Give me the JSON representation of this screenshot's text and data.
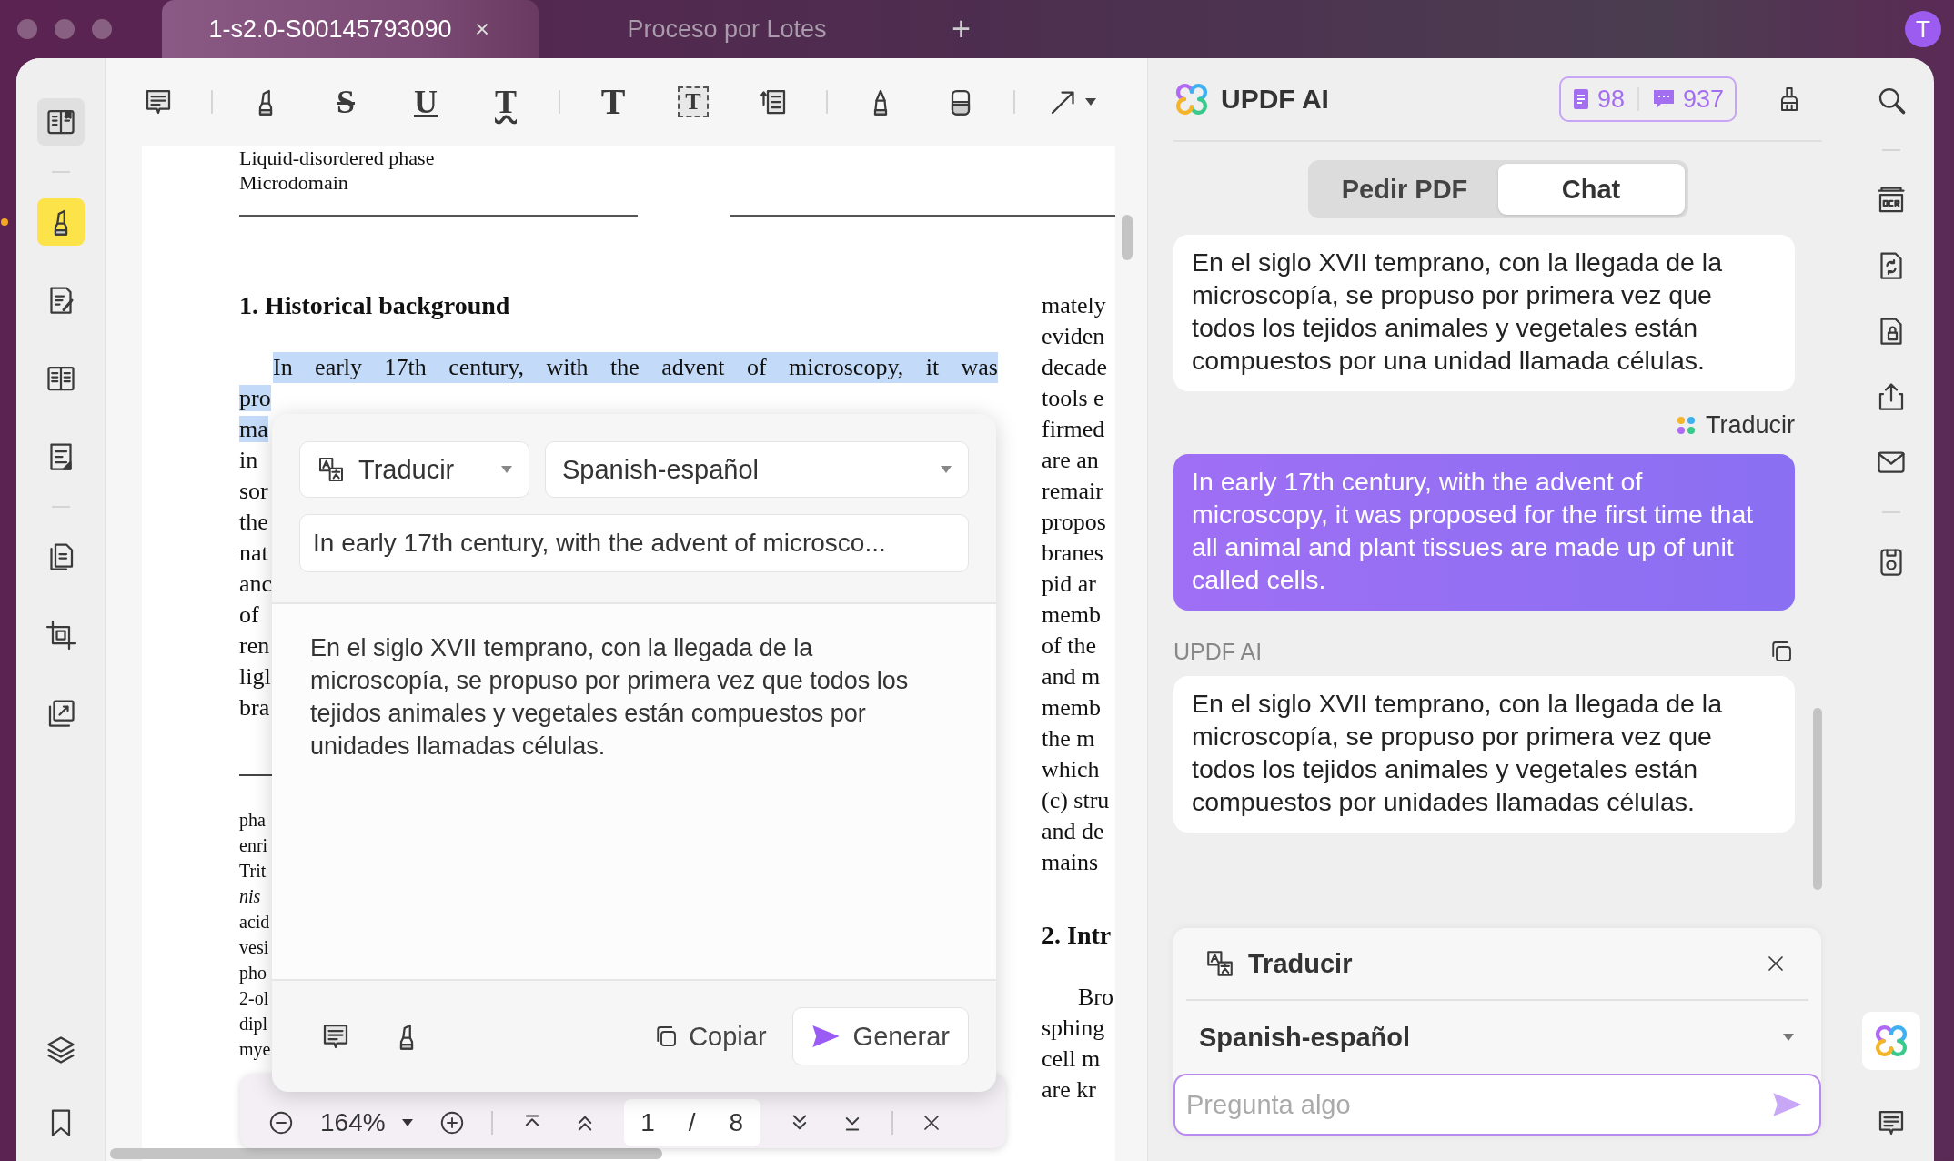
{
  "title_bar": {
    "tabs": [
      {
        "label": "1-s2.0-S00145793090",
        "selected": true
      },
      {
        "label": "Proceso por Lotes",
        "selected": false
      }
    ],
    "new_tab": "+",
    "avatar": "T"
  },
  "left_sidebar": {
    "reader_mode": {
      "on": true
    },
    "tools": [
      {
        "selected": true
      },
      {
        "selected": false
      },
      {
        "selected": false
      },
      {
        "selected": false
      },
      {
        "selected": false
      },
      {
        "selected": false
      },
      {
        "selected": false
      }
    ]
  },
  "toolbar": {
    "tools": [
      {
        "kind": "comment"
      },
      {
        "kind": "separator"
      },
      {
        "kind": "highlight"
      },
      {
        "kind": "strikethrough",
        "glyph": "S"
      },
      {
        "kind": "underline",
        "glyph": "U"
      },
      {
        "kind": "squiggly",
        "glyph": "T"
      },
      {
        "kind": "separator"
      },
      {
        "kind": "text",
        "glyph": "T"
      },
      {
        "kind": "textbox",
        "glyph": "T"
      },
      {
        "kind": "callout"
      },
      {
        "kind": "separator"
      },
      {
        "kind": "pencil"
      },
      {
        "kind": "eraser"
      },
      {
        "kind": "separator"
      },
      {
        "kind": "arrow"
      }
    ]
  },
  "document": {
    "header_lines": [
      "Liquid-disordered phase",
      "Microdomain"
    ],
    "left_column": {
      "heading": "1. Historical background",
      "paragraph": [
        {
          "text": "In early 17th century, with the advent of microscopy, it was",
          "highlighted": true
        },
        {
          "text": "pro",
          "highlighted": true
        },
        {
          "text": "ma",
          "highlighted": true
        },
        {
          "text": "in",
          "highlighted": false
        },
        {
          "text": "sor",
          "highlighted": false
        },
        {
          "text": "the",
          "highlighted": false
        },
        {
          "text": "nat",
          "highlighted": false
        },
        {
          "text": "anc",
          "highlighted": false
        },
        {
          "text": "of",
          "highlighted": false
        },
        {
          "text": "ren",
          "highlighted": false
        },
        {
          "text": "ligl",
          "highlighted": false
        },
        {
          "text": "bra",
          "highlighted": false
        }
      ],
      "footnotes": [
        {
          "text": "pha",
          "italic": false
        },
        {
          "text": "enri",
          "italic": false
        },
        {
          "text": "Trit",
          "italic": false
        },
        {
          "text": "nis",
          "italic": true
        },
        {
          "text": "acid",
          "italic": false
        },
        {
          "text": "vesi",
          "italic": false
        },
        {
          "text": "pho",
          "italic": false
        },
        {
          "text": "2-ol",
          "italic": false
        },
        {
          "text": "dipl",
          "italic": false
        },
        {
          "text": "mye",
          "italic": false
        }
      ]
    },
    "right_column": {
      "lines": [
        "mately",
        "eviden",
        "decade",
        "tools e",
        "firmed",
        "are an",
        "remair",
        "propos",
        "branes",
        "pid ar",
        "memb",
        "of the",
        "and m",
        "memb",
        "the m",
        "which",
        "(c) stru",
        "and de",
        "mains"
      ],
      "heading": "2. Intr",
      "lines_after": [
        "Bro",
        "sphing",
        "cell m",
        "are kr"
      ]
    }
  },
  "translate_popup": {
    "mode": "Traducir",
    "language": "Spanish-español",
    "source": "In early 17th century, with the advent of microsco...",
    "result": "En el siglo XVII temprano, con la llegada de la microscopía, se propuso por primera vez que todos los tejidos animales y vegetales están compuestos por unidades llamadas células.",
    "copy": "Copiar",
    "generate": "Generar"
  },
  "zoom_bar": {
    "zoom": "164%",
    "page": "1",
    "separator": "/",
    "total": "8"
  },
  "ai_panel": {
    "title": "UPDF AI",
    "pdf_credits": "98",
    "chat_credits": "937",
    "tabs": [
      {
        "label": "Pedir PDF",
        "selected": false
      },
      {
        "label": "Chat",
        "selected": true
      }
    ],
    "messages": [
      {
        "kind": "answer",
        "text": "En el siglo XVII temprano, con la llegada de la microscopía, se propuso por primera vez que todos los tejidos animales y vegetales están compuestos por una unidad llamada células."
      },
      {
        "kind": "question",
        "prompt": "Traducir",
        "text": "In early 17th century, with the advent of microscopy, it was proposed for the first time that all animal and plant tissues are made up of unit called cells."
      },
      {
        "kind": "answer",
        "sender": "UPDF AI",
        "text": "En el siglo XVII temprano, con la llegada de la microscopía, se propuso por primera vez que todos los tejidos animales y vegetales están compuestos por unidades llamadas células."
      }
    ],
    "prompt_box": {
      "mode": "Traducir",
      "language": "Spanish-español",
      "placeholder": "Pregunta algo"
    }
  }
}
